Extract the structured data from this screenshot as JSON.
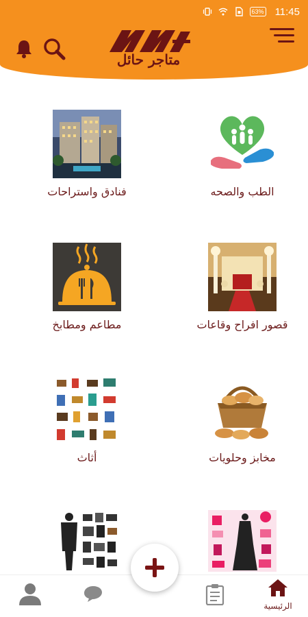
{
  "status": {
    "battery": "63%",
    "time": "11:45"
  },
  "header": {
    "logo_text": "متاجر حائل"
  },
  "categories": [
    {
      "label": "فنادق واستراحات",
      "icon": "hotel-image"
    },
    {
      "label": "الطب والصحه",
      "icon": "health-heart-image"
    },
    {
      "label": "مطاعم ومطابخ",
      "icon": "restaurant-cloche-image"
    },
    {
      "label": "قصور افراح وقاعات",
      "icon": "wedding-hall-image"
    },
    {
      "label": "أثاث",
      "icon": "furniture-image"
    },
    {
      "label": "مخابز وحلويات",
      "icon": "bakery-basket-image"
    },
    {
      "label": "",
      "icon": "mens-fashion-image"
    },
    {
      "label": "",
      "icon": "womens-fashion-image"
    }
  ],
  "bottom_nav": {
    "home_label": "الرئيسية"
  },
  "colors": {
    "accent": "#f5901e",
    "brand_dark": "#6b1414"
  }
}
